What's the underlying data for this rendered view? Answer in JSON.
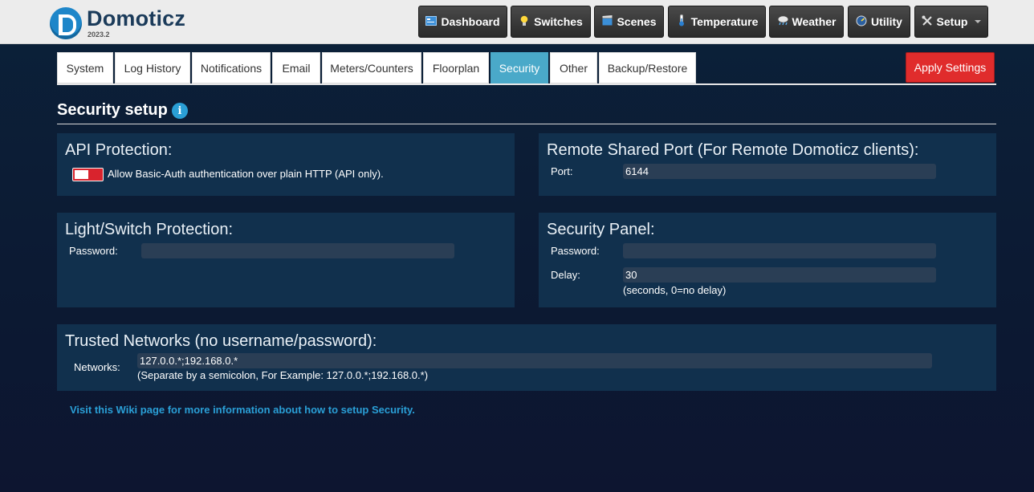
{
  "header": {
    "brand": "Domoticz",
    "version": "2023.2",
    "nav": [
      {
        "label": "Dashboard",
        "icon": "dashboard-icon"
      },
      {
        "label": "Switches",
        "icon": "lightbulb-icon"
      },
      {
        "label": "Scenes",
        "icon": "clapperboard-icon"
      },
      {
        "label": "Temperature",
        "icon": "thermometer-icon"
      },
      {
        "label": "Weather",
        "icon": "weather-cloud-icon"
      },
      {
        "label": "Utility",
        "icon": "utility-gauge-icon"
      },
      {
        "label": "Setup",
        "icon": "tools-icon"
      }
    ]
  },
  "tabs": [
    {
      "label": "System"
    },
    {
      "label": "Log History"
    },
    {
      "label": "Notifications"
    },
    {
      "label": "Email"
    },
    {
      "label": "Meters/Counters"
    },
    {
      "label": "Floorplan"
    },
    {
      "label": "Security",
      "active": true
    },
    {
      "label": "Other"
    },
    {
      "label": "Backup/Restore"
    }
  ],
  "apply_label": "Apply Settings",
  "page_title": "Security setup",
  "api_protection": {
    "title": "API Protection:",
    "toggle_label": "Allow Basic-Auth authentication over plain HTTP (API only).",
    "toggle_on": false
  },
  "remote_port": {
    "title": "Remote Shared Port (For Remote Domoticz clients):",
    "port_label": "Port:",
    "port_value": "6144"
  },
  "light_switch": {
    "title": "Light/Switch Protection:",
    "password_label": "Password:",
    "password_value": ""
  },
  "security_panel": {
    "title": "Security Panel:",
    "password_label": "Password:",
    "password_value": "",
    "delay_label": "Delay:",
    "delay_value": "30",
    "delay_hint": "(seconds, 0=no delay)"
  },
  "trusted_networks": {
    "title": "Trusted Networks (no username/password):",
    "label": "Networks:",
    "value": "127.0.0.*;192.168.0.*",
    "hint": "(Separate by a semicolon, For Example: 127.0.0.*;192.168.0.*)"
  },
  "wiki_link": "Visit this Wiki page for more information about how to setup Security.",
  "colors": {
    "accent": "#2a9fd6",
    "active_tab": "#4aa9c9",
    "apply_button": "#e02c2c",
    "toggle_off": "#d9232d",
    "panel": "#11304d"
  }
}
